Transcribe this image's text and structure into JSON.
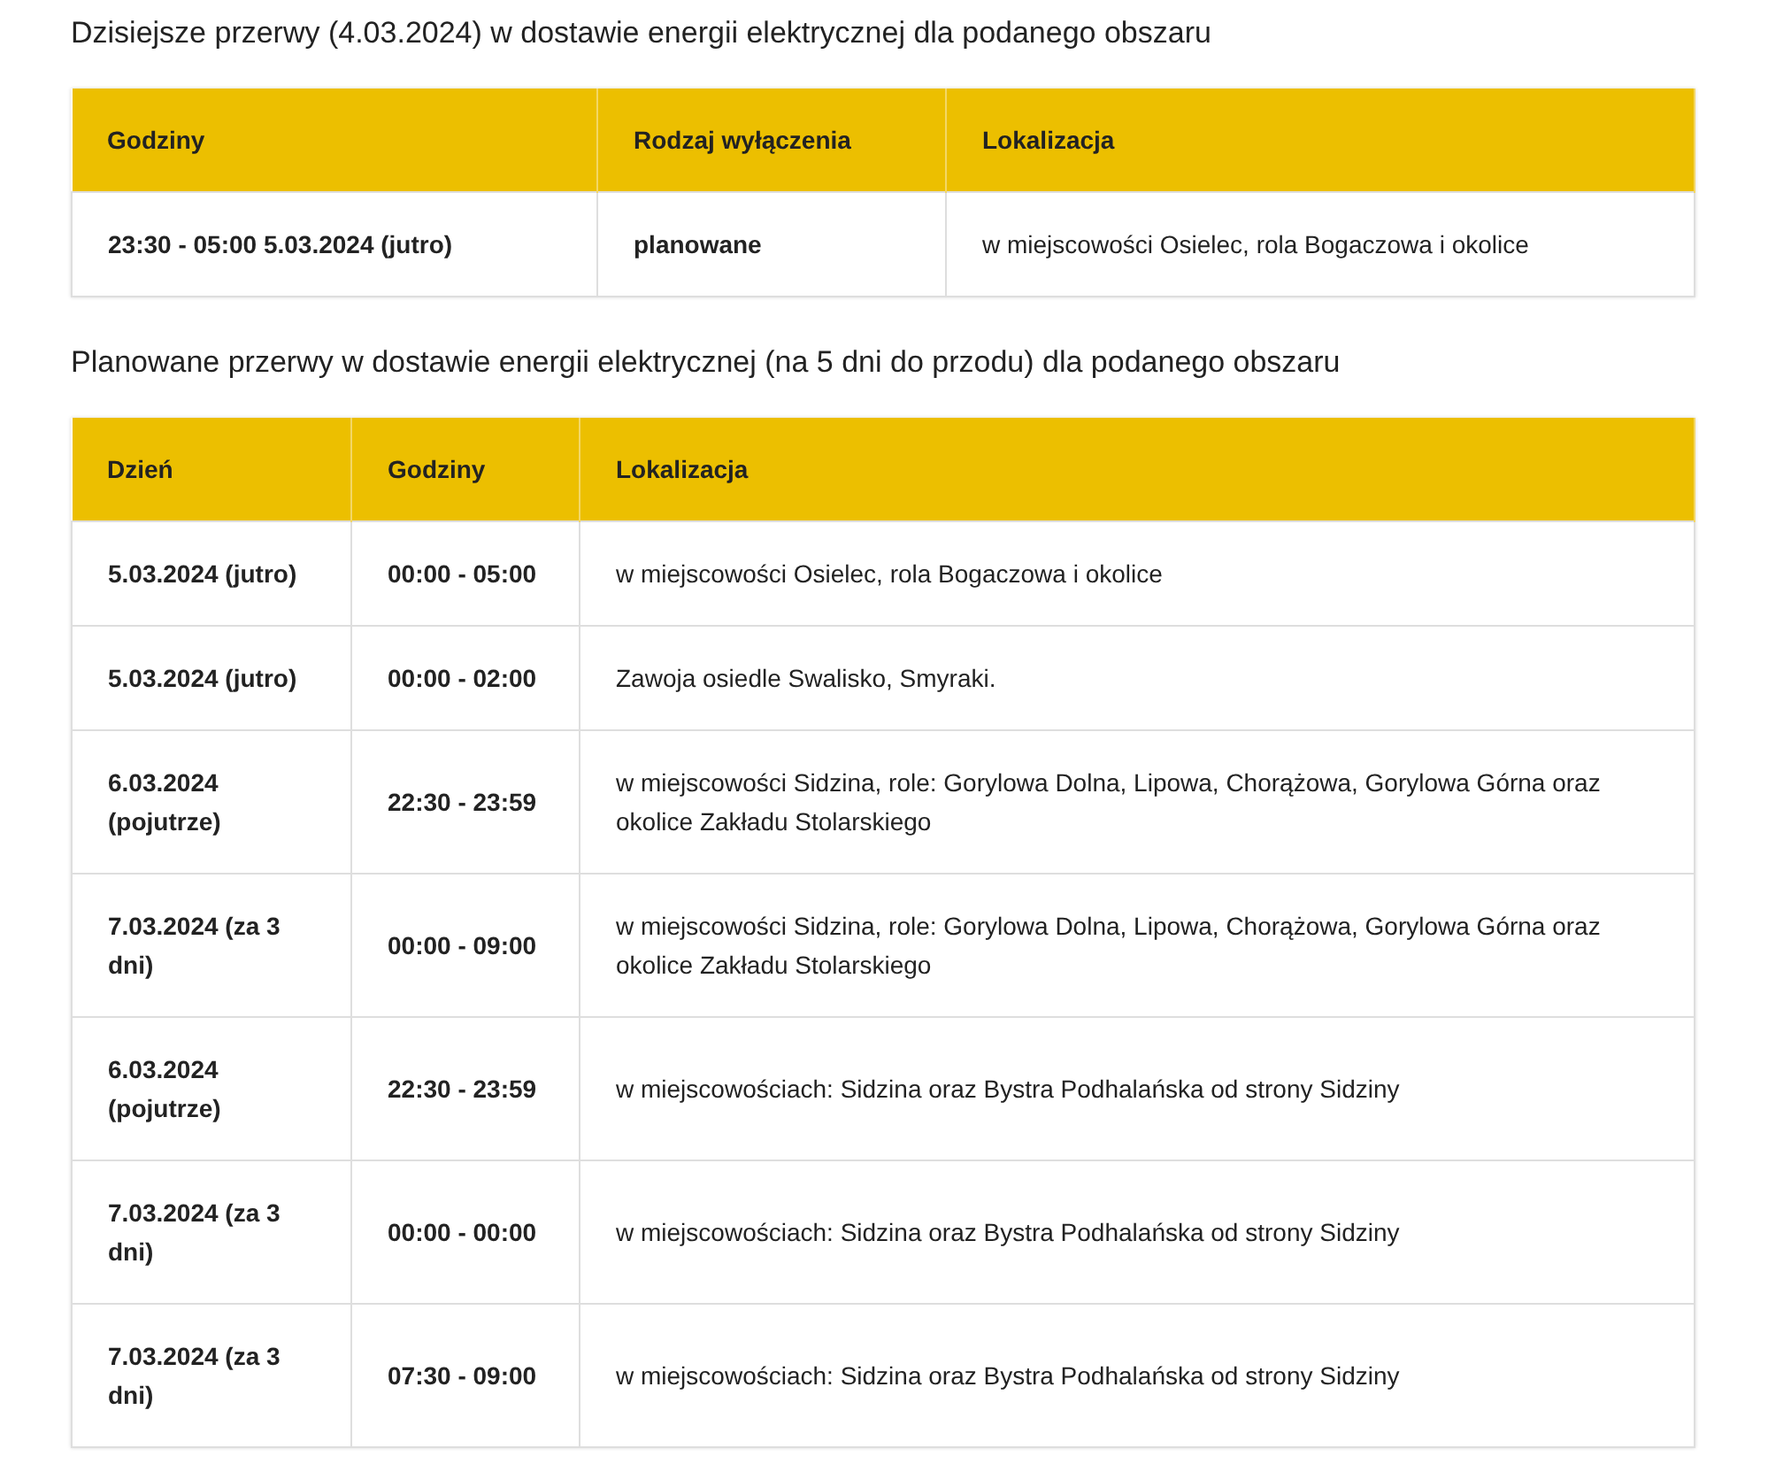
{
  "sections": [
    {
      "title": "Dzisiejsze przerwy (4.03.2024) w dostawie energii elektrycznej dla podanego obszaru",
      "columns": [
        "Godziny",
        "Rodzaj wyłączenia",
        "Lokalizacja"
      ],
      "rows": [
        [
          "23:30 - 05:00 5.03.2024 (jutro)",
          "planowane",
          "w miejscowości Osielec, rola Bogaczowa i okolice"
        ]
      ]
    },
    {
      "title": "Planowane przerwy w dostawie energii elektrycznej (na 5 dni do przodu) dla podanego obszaru",
      "columns": [
        "Dzień",
        "Godziny",
        "Lokalizacja"
      ],
      "rows": [
        [
          "5.03.2024 (jutro)",
          "00:00 - 05:00",
          "w miejscowości Osielec, rola Bogaczowa i okolice"
        ],
        [
          "5.03.2024 (jutro)",
          "00:00 - 02:00",
          "Zawoja osiedle Swalisko, Smyraki."
        ],
        [
          "6.03.2024 (pojutrze)",
          "22:30 - 23:59",
          "w miejscowości Sidzina, role: Gorylowa Dolna, Lipowa, Chorążowa, Gorylowa Górna oraz okolice Zakładu Stolarskiego"
        ],
        [
          "7.03.2024 (za 3 dni)",
          "00:00 - 09:00",
          "w miejscowości Sidzina, role: Gorylowa Dolna, Lipowa, Chorążowa, Gorylowa Górna oraz okolice Zakładu Stolarskiego"
        ],
        [
          "6.03.2024 (pojutrze)",
          "22:30 - 23:59",
          "w miejscowościach: Sidzina oraz Bystra Podhalańska od strony Sidziny"
        ],
        [
          "7.03.2024 (za 3 dni)",
          "00:00 - 00:00",
          "w miejscowościach: Sidzina oraz Bystra Podhalańska od strony Sidziny"
        ],
        [
          "7.03.2024 (za 3 dni)",
          "07:30 - 09:00",
          "w miejscowościach: Sidzina oraz Bystra Podhalańska od strony Sidziny"
        ]
      ]
    }
  ]
}
